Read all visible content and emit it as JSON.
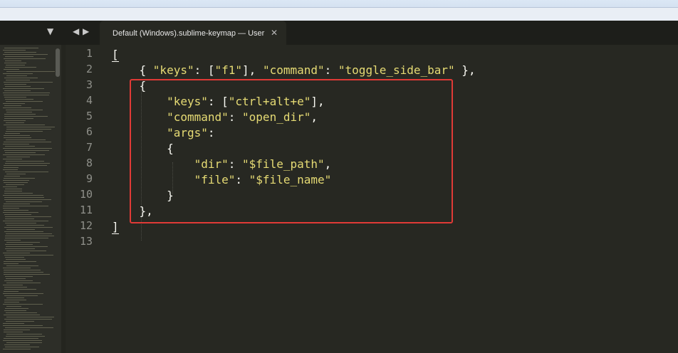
{
  "tabbar": {
    "arrow_down": "▼",
    "arrow_left": "◀",
    "arrow_right": "▶",
    "tab_title": "Default (Windows).sublime-keymap — User",
    "tab_close": "✕"
  },
  "gutter": {
    "line_numbers": [
      "1",
      "2",
      "3",
      "4",
      "5",
      "6",
      "7",
      "8",
      "9",
      "10",
      "11",
      "12",
      "13"
    ]
  },
  "code": {
    "lines": [
      {
        "tokens": [
          {
            "t": "[",
            "c": "p"
          }
        ]
      },
      {
        "tokens": [
          {
            "t": "    { ",
            "c": "p"
          },
          {
            "t": "\"keys\"",
            "c": "s"
          },
          {
            "t": ": [",
            "c": "p"
          },
          {
            "t": "\"f1\"",
            "c": "s"
          },
          {
            "t": "], ",
            "c": "p"
          },
          {
            "t": "\"command\"",
            "c": "s"
          },
          {
            "t": ": ",
            "c": "p"
          },
          {
            "t": "\"toggle_side_bar\"",
            "c": "s"
          },
          {
            "t": " },",
            "c": "p"
          }
        ]
      },
      {
        "tokens": [
          {
            "t": "    {",
            "c": "p"
          }
        ]
      },
      {
        "tokens": [
          {
            "t": "        ",
            "c": "p"
          },
          {
            "t": "\"keys\"",
            "c": "s"
          },
          {
            "t": ": [",
            "c": "p"
          },
          {
            "t": "\"ctrl+alt+e\"",
            "c": "s"
          },
          {
            "t": "],",
            "c": "p"
          }
        ]
      },
      {
        "tokens": [
          {
            "t": "        ",
            "c": "p"
          },
          {
            "t": "\"command\"",
            "c": "s"
          },
          {
            "t": ": ",
            "c": "p"
          },
          {
            "t": "\"open_dir\"",
            "c": "s"
          },
          {
            "t": ",",
            "c": "p"
          }
        ]
      },
      {
        "tokens": [
          {
            "t": "        ",
            "c": "p"
          },
          {
            "t": "\"args\"",
            "c": "s"
          },
          {
            "t": ":",
            "c": "p"
          }
        ]
      },
      {
        "tokens": [
          {
            "t": "        {",
            "c": "p"
          }
        ]
      },
      {
        "tokens": [
          {
            "t": "            ",
            "c": "p"
          },
          {
            "t": "\"dir\"",
            "c": "s"
          },
          {
            "t": ": ",
            "c": "p"
          },
          {
            "t": "\"$file_path\"",
            "c": "s"
          },
          {
            "t": ",",
            "c": "p"
          }
        ]
      },
      {
        "tokens": [
          {
            "t": "            ",
            "c": "p"
          },
          {
            "t": "\"file\"",
            "c": "s"
          },
          {
            "t": ": ",
            "c": "p"
          },
          {
            "t": "\"$file_name\"",
            "c": "s"
          }
        ]
      },
      {
        "tokens": [
          {
            "t": "        }",
            "c": "p"
          }
        ]
      },
      {
        "tokens": [
          {
            "t": "    },",
            "c": "p"
          }
        ]
      },
      {
        "tokens": [
          {
            "t": "]",
            "c": "p"
          }
        ]
      },
      {
        "tokens": [
          {
            "t": "",
            "c": "p"
          }
        ]
      }
    ]
  },
  "colors": {
    "background": "#272822",
    "string": "#e6db74",
    "punctuation": "#f8f8f2",
    "line_number": "#8f908a",
    "highlight_box": "#e03a36"
  }
}
